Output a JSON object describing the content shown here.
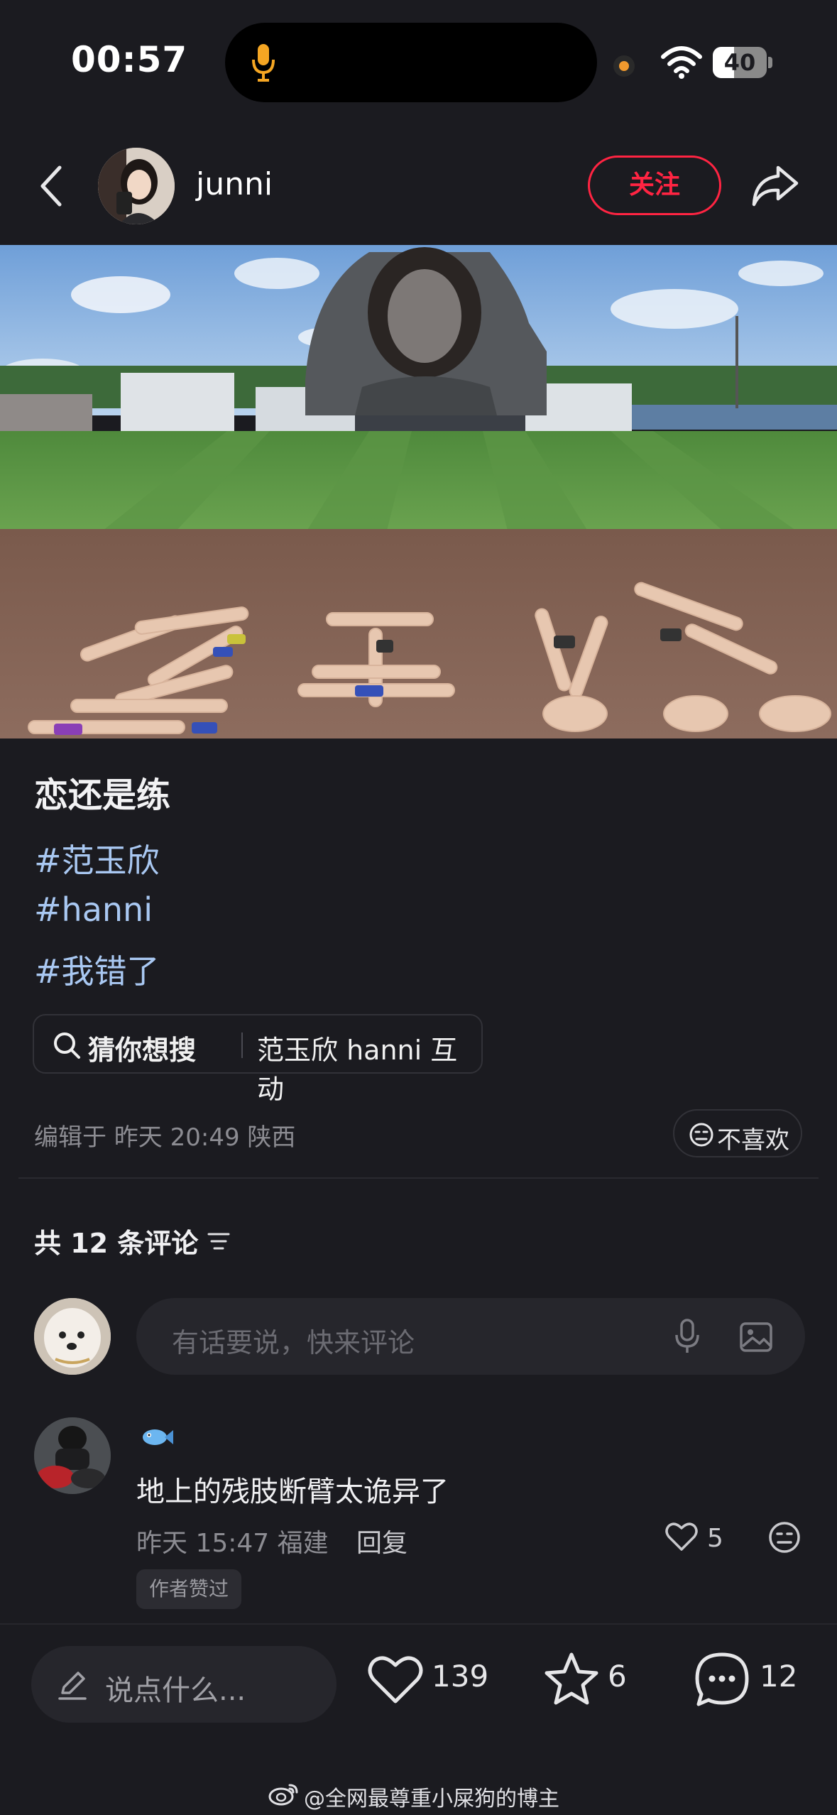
{
  "status_bar": {
    "time": "00:57",
    "battery_level": "40",
    "battery_fraction": 0.4
  },
  "header": {
    "username": "junni",
    "follow_label": "关注"
  },
  "post": {
    "title": "恋还是练",
    "hashtags": [
      "#范玉欣",
      "#hanni",
      "#我错了"
    ],
    "search_prefix": "猜你想搜",
    "search_query": "范玉欣 hanni 互动",
    "meta": "编辑于 昨天 20:49 陕西",
    "dislike_label": "不喜欢"
  },
  "comments": {
    "count_label": "共 12 条评论",
    "input_placeholder": "有话要说，快来评论",
    "items": [
      {
        "text": "地上的残肢断臂太诡异了",
        "meta": "昨天 15:47 福建",
        "reply_label": "回复",
        "likes": "5",
        "badge": "作者赞过"
      }
    ]
  },
  "bottom_bar": {
    "say_label": "说点什么...",
    "likes": "139",
    "stars": "6",
    "comments": "12"
  },
  "watermark": "@全网最尊重小屎狗的博主",
  "colors": {
    "background": "#1b1b20",
    "accent_red": "#ff2442",
    "hashtag_blue": "#a9c8f2"
  }
}
